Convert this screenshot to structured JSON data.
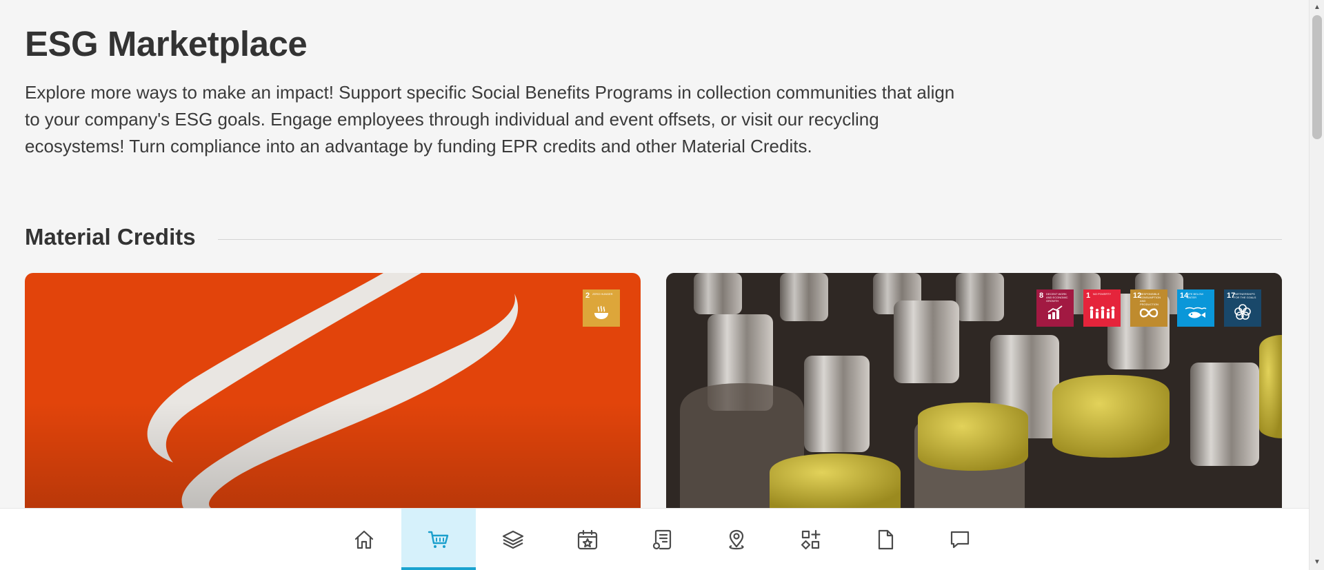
{
  "header": {
    "title": "ESG Marketplace",
    "intro": "Explore more ways to make an impact! Support specific Social Benefits Programs in collection communities that align to your company's ESG goals. Engage employees through individual and event offsets, or visit our recycling ecosystems! Turn compliance into an advantage by funding EPR credits and other Material Credits."
  },
  "section": {
    "title": "Material Credits"
  },
  "cards": [
    {
      "sdgs": [
        {
          "number": "2",
          "text": "ZERO HUNGER",
          "color": "#dda63a",
          "icon": "bowl-icon"
        }
      ]
    },
    {
      "sdgs": [
        {
          "number": "8",
          "text": "DECENT WORK AND ECONOMIC GROWTH",
          "color": "#a21942",
          "icon": "growth-chart-icon"
        },
        {
          "number": "1",
          "text": "NO POVERTY",
          "color": "#e5243b",
          "icon": "family-icon"
        },
        {
          "number": "12",
          "text": "RESPONSIBLE CONSUMPTION AND PRODUCTION",
          "color": "#bf8b2e",
          "icon": "infinity-icon"
        },
        {
          "number": "14",
          "text": "LIFE BELOW WATER",
          "color": "#0a97d9",
          "icon": "fish-icon"
        },
        {
          "number": "17",
          "text": "PARTNERSHIPS FOR THE GOALS",
          "color": "#19486a",
          "icon": "flower-icon"
        }
      ]
    }
  ],
  "bottom_nav": {
    "active": "cart",
    "items": [
      "home-icon",
      "cart-icon",
      "layers-icon",
      "calendar-star-icon",
      "document-list-icon",
      "map-pin-icon",
      "shapes-icon",
      "file-icon",
      "chat-icon"
    ]
  },
  "colors": {
    "accent": "#1aa3cf",
    "active_bg": "#d6f1fb",
    "card_orange": "#e2440b"
  }
}
